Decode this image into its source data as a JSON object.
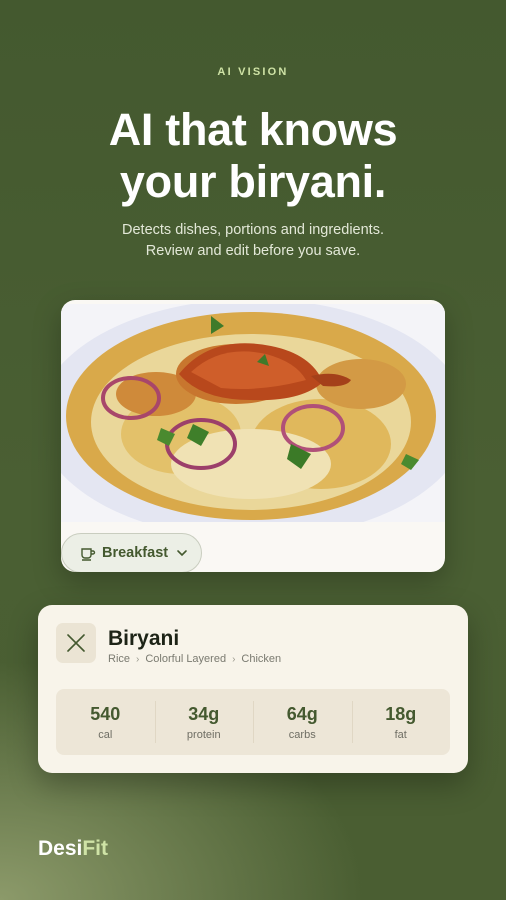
{
  "eyebrow": "AI VISION",
  "headline": {
    "line1": "AI that knows",
    "line2": "your biryani."
  },
  "subtitle": {
    "line1": "Detects dishes, portions and ingredients.",
    "line2": "Review and edit before you save."
  },
  "meal_selector": {
    "label": "Breakfast",
    "icon": "cup-icon",
    "chevron": "chevron-down-icon"
  },
  "result": {
    "dish": "Biryani",
    "tags": [
      "Rice",
      "Colorful Layered",
      "Chicken"
    ],
    "macros": [
      {
        "value": "540",
        "label": "cal"
      },
      {
        "value": "34g",
        "label": "protein"
      },
      {
        "value": "64g",
        "label": "carbs"
      },
      {
        "value": "18g",
        "label": "fat"
      }
    ]
  },
  "brand": {
    "part1": "Desi",
    "part2": "Fit"
  },
  "colors": {
    "background": "#44592f",
    "accent": "#cfe3a6",
    "card": "#f8f4ea",
    "macro_value": "#44592f"
  }
}
